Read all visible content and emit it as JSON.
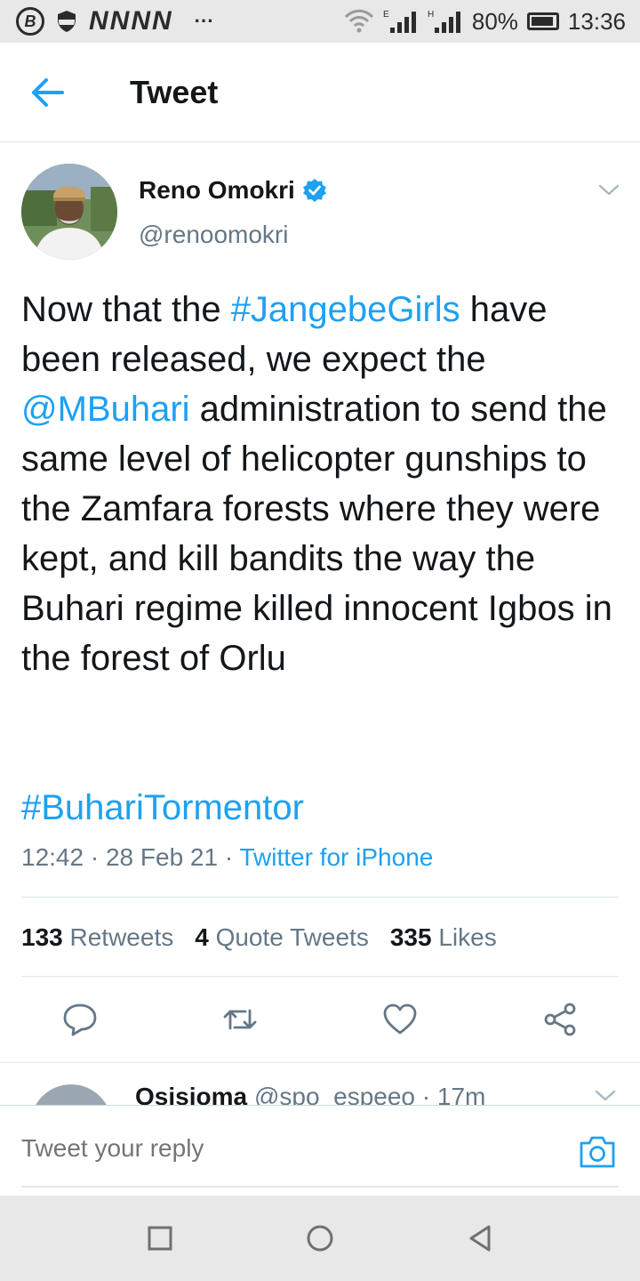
{
  "status_bar": {
    "left_icon_letter": "B",
    "notification_letters": "NNNN",
    "more": "···",
    "network_labels": [
      "E",
      "H"
    ],
    "battery": "80%",
    "time": "13:36"
  },
  "header": {
    "title": "Tweet",
    "back_icon": "arrow-left-icon"
  },
  "tweet": {
    "author": {
      "name": "Reno Omokri",
      "handle": "@renoomokri",
      "verified": true
    },
    "text": {
      "part1": "Now that the ",
      "hashtag1": "#JangebeGirls",
      "part2": " have been released, we expect the ",
      "mention": "@MBuhari",
      "part3": " administration to send the same level of helicopter gunships to the Zamfara forests where they were kept, and kill bandits the way the Buhari regime killed innocent Igbos in the forest of Orlu",
      "hashtag2": "#BuhariTormentor"
    },
    "meta": {
      "time": "12:42",
      "separator": " · ",
      "date": "28 Feb 21",
      "source": "Twitter for iPhone"
    },
    "stats": {
      "retweets_count": "133",
      "retweets_label": "Retweets",
      "quotes_count": "4",
      "quotes_label": "Quote Tweets",
      "likes_count": "335",
      "likes_label": "Likes"
    },
    "actions": [
      "reply-icon",
      "retweet-icon",
      "like-icon",
      "share-icon"
    ]
  },
  "reply_preview": {
    "name": "Osisioma",
    "handle_time": "@spo_espeeo · 17m"
  },
  "composer": {
    "placeholder": "Tweet your reply",
    "camera_icon": "camera-icon"
  },
  "colors": {
    "accent": "#1da1f2",
    "text": "#14171a",
    "secondary": "#657786",
    "verified": "#1da1f2",
    "status_bar_bg": "#e8e8e8"
  }
}
